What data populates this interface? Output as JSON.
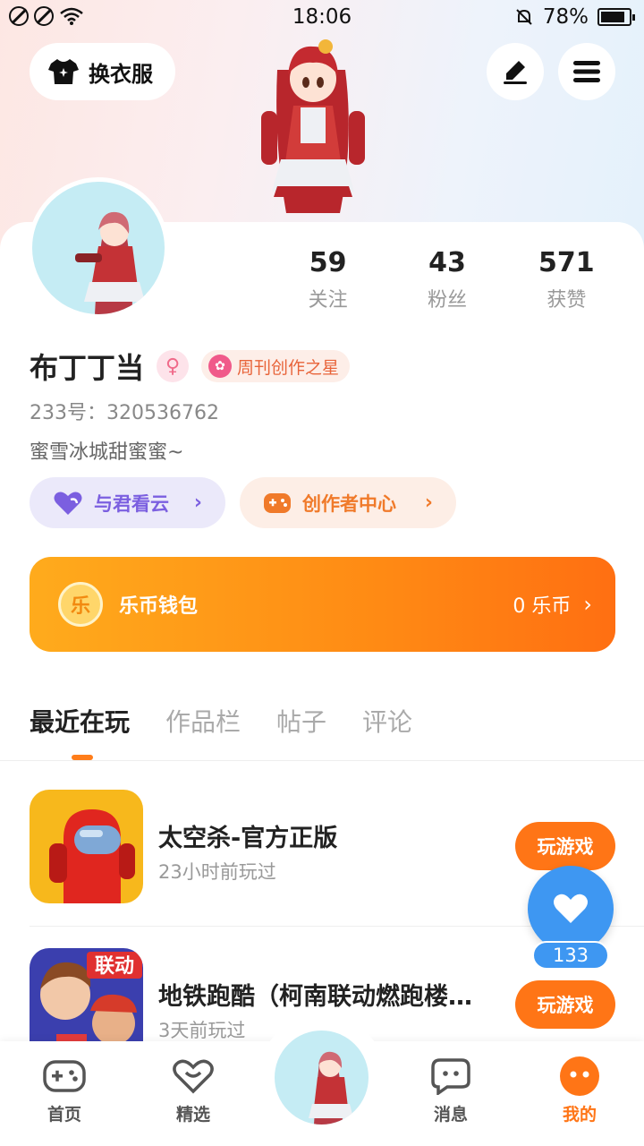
{
  "status_bar": {
    "time": "18:06",
    "battery": "78%"
  },
  "header": {
    "outfit_label": "换衣服"
  },
  "profile": {
    "stats": [
      {
        "value": "59",
        "label": "关注"
      },
      {
        "value": "43",
        "label": "粉丝"
      },
      {
        "value": "571",
        "label": "获赞"
      }
    ],
    "nickname": "布丁丁当",
    "badge_label": "周刊创作之星",
    "uid": "233号：320536762",
    "bio": "蜜雪冰城甜蜜蜜~"
  },
  "links": {
    "cloud_label": "与君看云",
    "creator_label": "创作者中心"
  },
  "wallet": {
    "coin_glyph": "乐",
    "title": "乐币钱包",
    "amount": "0 乐币"
  },
  "tabs": [
    "最近在玩",
    "作品栏",
    "帖子",
    "评论"
  ],
  "games": [
    {
      "title": "太空杀-官方正版",
      "time": "23小时前玩过",
      "button": "玩游戏"
    },
    {
      "title": "地铁跑酷（柯南联动燃跑楼…",
      "time": "3天前玩过",
      "button": "玩游戏",
      "icon_text": "联动"
    }
  ],
  "like_count": "133",
  "bottom_nav": [
    "首页",
    "精选",
    "消息",
    "我的"
  ],
  "colors": {
    "accent": "#ff7516",
    "like_blue": "#3e97f2"
  }
}
